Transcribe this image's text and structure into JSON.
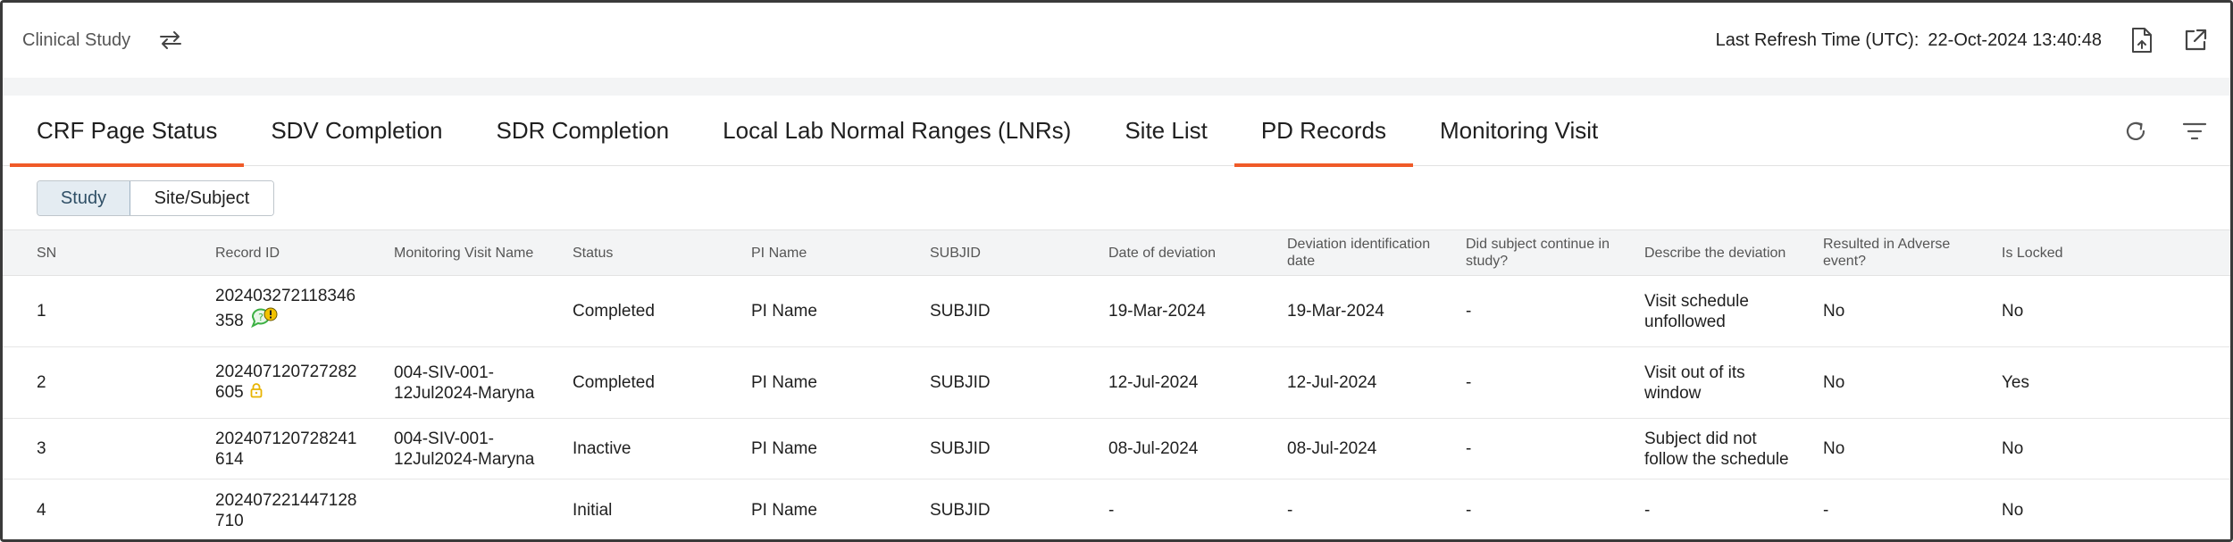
{
  "header": {
    "app_title": "Clinical Study",
    "refresh_label": "Last Refresh Time (UTC):",
    "refresh_value": "22-Oct-2024 13:40:48"
  },
  "tabs": [
    {
      "label": "CRF Page Status",
      "active": true
    },
    {
      "label": "SDV Completion",
      "active": false
    },
    {
      "label": "SDR Completion",
      "active": false
    },
    {
      "label": "Local Lab Normal Ranges (LNRs)",
      "active": false
    },
    {
      "label": "Site List",
      "active": false
    },
    {
      "label": "PD Records",
      "active": true
    },
    {
      "label": "Monitoring Visit",
      "active": false
    }
  ],
  "view_toggle": {
    "options": [
      "Study",
      "Site/Subject"
    ],
    "selected": "Study"
  },
  "table": {
    "columns": [
      "SN",
      "Record ID",
      "Monitoring Visit Name",
      "Status",
      "PI Name",
      "SUBJID",
      "Date of deviation",
      "Deviation identification date",
      "Did subject continue in study?",
      "Describe the deviation",
      "Resulted in Adverse event?",
      "Is Locked"
    ],
    "rows": [
      {
        "sn": "1",
        "record_id": "202403272118346358",
        "record_icon": "comment-alert-icon",
        "monitoring_visit_name": "",
        "status": "Completed",
        "pi_name": "PI Name",
        "subjid": "SUBJID",
        "date_of_deviation": "19-Mar-2024",
        "deviation_identification_date": "19-Mar-2024",
        "continue_in_study": "-",
        "description": "Visit schedule unfollowed",
        "adverse_event": "No",
        "is_locked": "No"
      },
      {
        "sn": "2",
        "record_id": "202407120727282605",
        "record_icon": "lock-icon",
        "monitoring_visit_name": "004-SIV-001-12Jul2024-Maryna",
        "status": "Completed",
        "pi_name": "PI Name",
        "subjid": "SUBJID",
        "date_of_deviation": "12-Jul-2024",
        "deviation_identification_date": "12-Jul-2024",
        "continue_in_study": "-",
        "description": "Visit out of its window",
        "adverse_event": "No",
        "is_locked": "Yes"
      },
      {
        "sn": "3",
        "record_id": "202407120728241614",
        "record_icon": "",
        "monitoring_visit_name": "004-SIV-001-12Jul2024-Maryna",
        "status": "Inactive",
        "pi_name": "PI Name",
        "subjid": "SUBJID",
        "date_of_deviation": "08-Jul-2024",
        "deviation_identification_date": "08-Jul-2024",
        "continue_in_study": "-",
        "description": "Subject did not follow the schedule",
        "adverse_event": "No",
        "is_locked": "No"
      },
      {
        "sn": "4",
        "record_id": "202407221447128710",
        "record_icon": "",
        "monitoring_visit_name": "",
        "status": "Initial",
        "pi_name": "PI Name",
        "subjid": "SUBJID",
        "date_of_deviation": "-",
        "deviation_identification_date": "-",
        "continue_in_study": "-",
        "description": "-",
        "adverse_event": "-",
        "is_locked": "No"
      }
    ]
  },
  "colors": {
    "accent": "#f05a28",
    "comment_icon_green": "#3cb043",
    "alert_yellow": "#f2c200",
    "lock_yellow": "#e8b400"
  }
}
